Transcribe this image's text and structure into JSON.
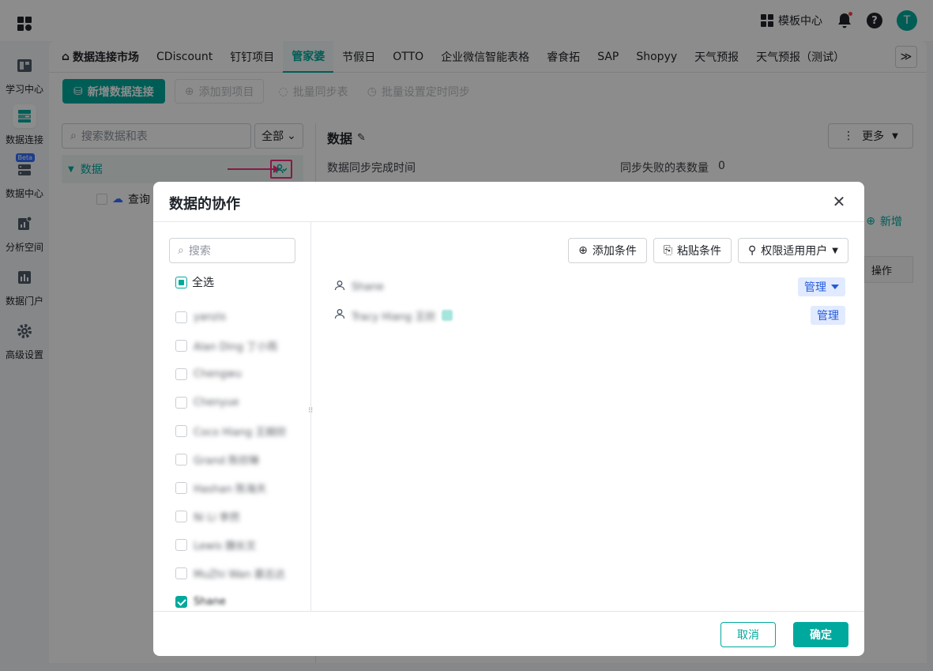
{
  "topbar": {
    "template_center_label": "模板中心",
    "avatar_initial": "T"
  },
  "sidebar": {
    "items": [
      {
        "label": "学习中心",
        "icon": "book-icon"
      },
      {
        "label": "数据连接",
        "icon": "database-connect-icon",
        "active": true
      },
      {
        "label": "数据中心",
        "icon": "server-icon",
        "badge": "Beta"
      },
      {
        "label": "分析空间",
        "icon": "chart-doc-icon"
      },
      {
        "label": "数据门户",
        "icon": "bar-chart-icon"
      },
      {
        "label": "高级设置",
        "icon": "gear-icon"
      }
    ]
  },
  "tabs": {
    "home_label": "数据连接市场",
    "items": [
      "CDiscount",
      "钉钉项目",
      "管家婆",
      "节假日",
      "OTTO",
      "企业微信智能表格",
      "睿食拓",
      "SAP",
      "Shopyy",
      "天气预报",
      "天气预报（测试）"
    ],
    "active": "管家婆"
  },
  "toolbar": {
    "new_connection": "新增数据连接",
    "add_to_project": "添加到项目",
    "batch_sync": "批量同步表",
    "batch_schedule": "批量设置定时同步"
  },
  "left_pane": {
    "search_placeholder": "搜索数据和表",
    "filter_value": "全部",
    "node_label": "数据",
    "child_label": "查询"
  },
  "right_pane": {
    "title": "数据",
    "more_label": "更多",
    "sync_time_label": "数据同步完成时间",
    "fail_count_label": "同步失败的表数量",
    "fail_count_value": "0",
    "add_label": "新增",
    "col_action": "操作",
    "cell_ellipsis": "..."
  },
  "modal": {
    "title": "数据的协作",
    "search_placeholder": "搜索",
    "select_all_label": "全选",
    "users": [
      {
        "name": "yanzis",
        "checked": false
      },
      {
        "name": "Alan Ding 丁小雨",
        "checked": false
      },
      {
        "name": "Chengwu",
        "checked": false
      },
      {
        "name": "Chenyue",
        "checked": false
      },
      {
        "name": "Coco Hiang 王婉欣",
        "checked": false
      },
      {
        "name": "Grand 陈欣琳",
        "checked": false
      },
      {
        "name": "Hashan 陈海天",
        "checked": false
      },
      {
        "name": "Ni Li 李然",
        "checked": false
      },
      {
        "name": "Lewis 魏长文",
        "checked": false
      },
      {
        "name": "MuZhi Wan 慕志达",
        "checked": false
      },
      {
        "name": "Shane",
        "checked": true
      }
    ],
    "actions": {
      "add_condition": "添加条件",
      "paste_condition": "粘贴条件",
      "applicable_users": "权限适用用户"
    },
    "permissions": [
      {
        "user": "Shane",
        "role": "管理",
        "dropdown": true
      },
      {
        "user": "Tracy Hiang 王欣",
        "role": "管理",
        "dropdown": false
      }
    ],
    "cancel_label": "取消",
    "confirm_label": "确定"
  },
  "colors": {
    "accent": "#00a99d",
    "highlight": "#f5317f",
    "role_tag_bg": "#e1eaff",
    "role_tag_text": "#245bdb"
  }
}
